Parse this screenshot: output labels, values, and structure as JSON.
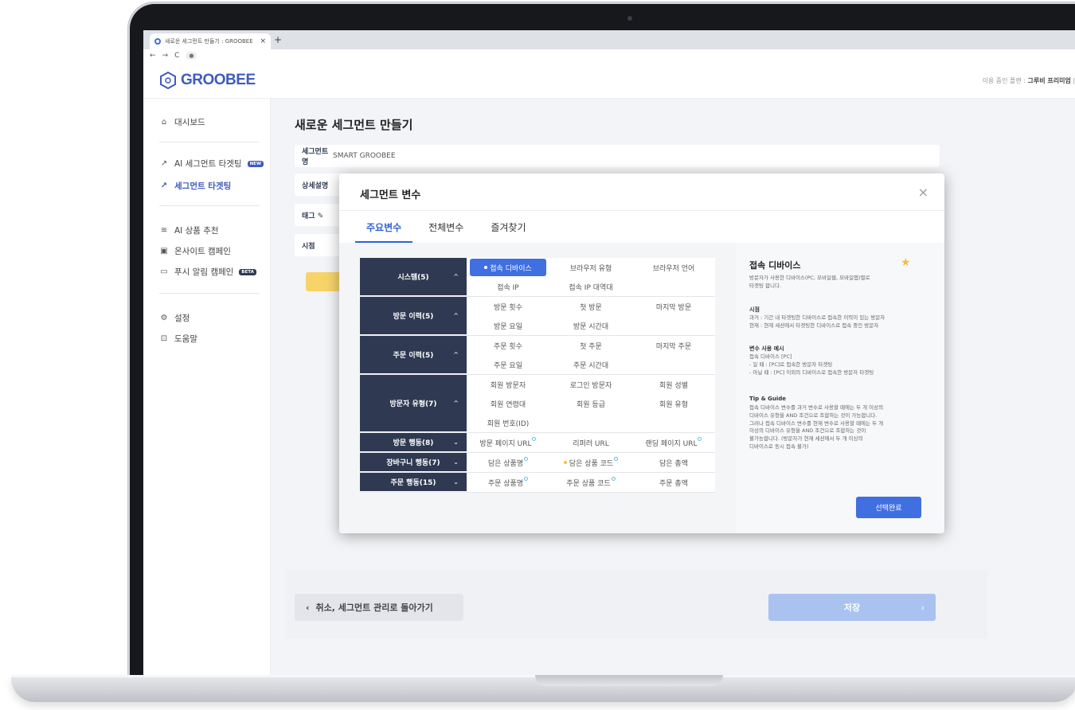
{
  "browser": {
    "tab_title": "새로운 세그먼트 만들기 : GROOBEE",
    "tab_close": "×",
    "new_tab": "+",
    "nav": {
      "back": "←",
      "forward": "→",
      "reload": "C",
      "lock": "●"
    }
  },
  "app": {
    "logo": "GROOBEE",
    "top_right_prefix": "이용 중인 플랜 : ",
    "top_right_plan": "그루비 프리미엄",
    "top_right_suffix": " | 남"
  },
  "sidebar": {
    "items": [
      {
        "label": "대시보드",
        "icon": "home-icon",
        "glyph": "⌂"
      },
      {
        "label": "AI 세그먼트 타겟팅",
        "icon": "target-ai-icon",
        "glyph": "↗",
        "badge": "NEW"
      },
      {
        "label": "세그먼트 타겟팅",
        "icon": "target-icon",
        "glyph": "↗",
        "active": true
      },
      {
        "label": "AI 상품 추천",
        "icon": "recommend-icon",
        "glyph": "≋"
      },
      {
        "label": "온사이트 캠페인",
        "icon": "onsite-icon",
        "glyph": "▣"
      },
      {
        "label": "푸시 알림 캠페인",
        "icon": "push-icon",
        "glyph": "▭",
        "badge": "BETA"
      },
      {
        "label": "설정",
        "icon": "gear-icon",
        "glyph": "⚙"
      },
      {
        "label": "도움말",
        "icon": "help-icon",
        "glyph": "⊡"
      }
    ]
  },
  "page": {
    "title": "새로운 세그먼트 만들기",
    "rows": [
      {
        "label": "세그먼트명",
        "value": "SMART GROOBEE"
      },
      {
        "label": "상세설명",
        "value": ""
      },
      {
        "label": "태그 ✎",
        "value": ""
      },
      {
        "label": "시점",
        "value": ""
      }
    ],
    "back_label": "취소, 세그먼트 관리로 돌아가기",
    "back_chevron": "‹",
    "save_label": "저장",
    "save_chevron": "›"
  },
  "modal": {
    "title": "세그먼트 변수",
    "close": "×",
    "tabs": [
      "주요변수",
      "전체변수",
      "즐겨찾기"
    ],
    "active_tab": 0,
    "groups": [
      {
        "name": "시스템(5)",
        "caret": "^",
        "vars": [
          {
            "label": "접속 디바이스",
            "selected": true
          },
          {
            "label": "브라우저 유형"
          },
          {
            "label": "브라우저 언어"
          },
          {
            "label": "접속 IP"
          },
          {
            "label": "접속 IP 대역대"
          }
        ]
      },
      {
        "name": "방문 이력(5)",
        "caret": "^",
        "vars": [
          {
            "label": "방문 횟수"
          },
          {
            "label": "첫 방문"
          },
          {
            "label": "마지막 방문"
          },
          {
            "label": "방문 요일"
          },
          {
            "label": "방문 시간대"
          }
        ]
      },
      {
        "name": "주문 이력(5)",
        "caret": "^",
        "vars": [
          {
            "label": "주문 횟수"
          },
          {
            "label": "첫 주문"
          },
          {
            "label": "마지막 주문"
          },
          {
            "label": "주문 요일"
          },
          {
            "label": "주문 시간대"
          }
        ]
      },
      {
        "name": "방문자 유형(7)",
        "caret": "^",
        "vars": [
          {
            "label": "회원 방문자"
          },
          {
            "label": "로그인 방문자"
          },
          {
            "label": "회원 성별"
          },
          {
            "label": "회원 연령대"
          },
          {
            "label": "회원 등급"
          },
          {
            "label": "회원 유형"
          },
          {
            "label": "회원 번호(ID)"
          }
        ]
      },
      {
        "name": "방문 행동(8)",
        "caret": "⌄",
        "vars": [
          {
            "label": "방문 페이지 URL",
            "marker": "blue"
          },
          {
            "label": "리퍼러 URL"
          },
          {
            "label": "랜딩 페이지 URL",
            "marker": "blue"
          }
        ]
      },
      {
        "name": "장바구니 행동(7)",
        "caret": "⌄",
        "vars": [
          {
            "label": "담은 상품명",
            "marker": "blue"
          },
          {
            "label": "담은 상품 코드",
            "marker": "blue",
            "prefix_dot": "yellow"
          },
          {
            "label": "담은 총액"
          }
        ]
      },
      {
        "name": "주문 행동(15)",
        "caret": "⌄",
        "vars": [
          {
            "label": "주문 상품명",
            "marker": "blue"
          },
          {
            "label": "주문 상품 코드",
            "marker": "blue"
          },
          {
            "label": "주문 총액"
          }
        ]
      }
    ],
    "info": {
      "title": "접속 디바이스",
      "star": "★",
      "desc": "방문자가 사용한 디바이스(PC, 모바일웹, 모바일앱)별로\n타겟팅 합니다.",
      "h_timepoint": "시점",
      "timepoint": "과거 : 기간 내 타겟팅한 디바이스로 접속한 이력이 있는 방문자\n현재 : 현재 세션에서 타겟팅한 디바이스로 접속 중인 방문자",
      "h_example": "변수 사용 예시",
      "example": "접속 디바이스 [PC]\n- 일 때 : [PC]로 접속한 방문자 타겟팅\n- 아닐 때 : [PC] 이외의 디바이스로 접속한 방문자 타겟팅",
      "h_tip": "Tip & Guide",
      "tip": "접속 디바이스 변수를 과거 변수로 사용할 때에는 두 개 이상의\n디바이스 유형을 AND 조건으로 조합하는 것이 가능합니다.\n그러나 접속 디바이스 변수를 현재 변수로 사용할 때에는 두 개\n이상의 디바이스 유형을 AND 조건으로 조합하는 것이\n불가능합니다. (방문자가 현재 세션에서 두 개 이상의\n디바이스로 동시 접속 불가)",
      "confirm": "선택완료"
    }
  },
  "colors": {
    "brand": "#3f5bbd",
    "selected": "#3f6fe0",
    "group_head": "#2f3a52",
    "star": "#f2c23c"
  }
}
